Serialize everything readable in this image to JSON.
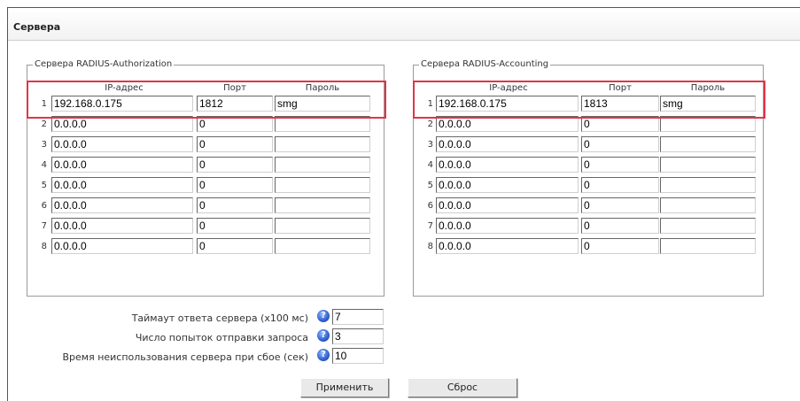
{
  "panel": {
    "title": "Сервера"
  },
  "auth": {
    "legend": "Сервера RADIUS-Authorization",
    "headers": {
      "ip": "IP-адрес",
      "port": "Порт",
      "password": "Пароль"
    },
    "rows": [
      {
        "n": "1",
        "ip": "192.168.0.175",
        "port": "1812",
        "password": "smg"
      },
      {
        "n": "2",
        "ip": "0.0.0.0",
        "port": "0",
        "password": ""
      },
      {
        "n": "3",
        "ip": "0.0.0.0",
        "port": "0",
        "password": ""
      },
      {
        "n": "4",
        "ip": "0.0.0.0",
        "port": "0",
        "password": ""
      },
      {
        "n": "5",
        "ip": "0.0.0.0",
        "port": "0",
        "password": ""
      },
      {
        "n": "6",
        "ip": "0.0.0.0",
        "port": "0",
        "password": ""
      },
      {
        "n": "7",
        "ip": "0.0.0.0",
        "port": "0",
        "password": ""
      },
      {
        "n": "8",
        "ip": "0.0.0.0",
        "port": "0",
        "password": ""
      }
    ]
  },
  "acct": {
    "legend": "Сервера RADIUS-Accounting",
    "headers": {
      "ip": "IP-адрес",
      "port": "Порт",
      "password": "Пароль"
    },
    "rows": [
      {
        "n": "1",
        "ip": "192.168.0.175",
        "port": "1813",
        "password": "smg"
      },
      {
        "n": "2",
        "ip": "0.0.0.0",
        "port": "0",
        "password": ""
      },
      {
        "n": "3",
        "ip": "0.0.0.0",
        "port": "0",
        "password": ""
      },
      {
        "n": "4",
        "ip": "0.0.0.0",
        "port": "0",
        "password": ""
      },
      {
        "n": "5",
        "ip": "0.0.0.0",
        "port": "0",
        "password": ""
      },
      {
        "n": "6",
        "ip": "0.0.0.0",
        "port": "0",
        "password": ""
      },
      {
        "n": "7",
        "ip": "0.0.0.0",
        "port": "0",
        "password": ""
      },
      {
        "n": "8",
        "ip": "0.0.0.0",
        "port": "0",
        "password": ""
      }
    ]
  },
  "settings": {
    "timeout_label": "Таймаут ответа сервера (х100 мс)",
    "timeout_value": "7",
    "retries_label": "Число попыток отправки запроса",
    "retries_value": "3",
    "dead_time_label": "Время неиспользования сервера при сбое (сек)",
    "dead_time_value": "10",
    "help_icon": "question-circle-icon",
    "help_glyph": "?"
  },
  "buttons": {
    "apply": "Применить",
    "reset": "Сброс"
  },
  "colors": {
    "highlight": "#e0354a",
    "help_blue": "#2f5fd0"
  }
}
